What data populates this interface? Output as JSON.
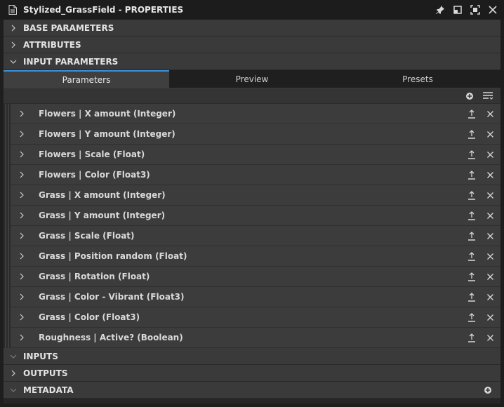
{
  "window": {
    "title": "Stylized_GrassField - PROPERTIES"
  },
  "sections": {
    "base_parameters": "BASE PARAMETERS",
    "attributes": "ATTRIBUTES",
    "input_parameters": "INPUT PARAMETERS",
    "inputs": "INPUTS",
    "outputs": "OUTPUTS",
    "metadata": "METADATA"
  },
  "tabs": [
    {
      "label": "Parameters",
      "active": true
    },
    {
      "label": "Preview",
      "active": false
    },
    {
      "label": "Presets",
      "active": false
    }
  ],
  "parameters": [
    "Flowers | X amount (Integer)",
    "Flowers | Y amount (Integer)",
    "Flowers | Scale (Float)",
    "Flowers | Color (Float3)",
    "Grass | X amount (Integer)",
    "Grass | Y amount (Integer)",
    "Grass | Scale (Float)",
    "Grass | Position random (Float)",
    "Grass | Rotation (Float)",
    "Grass | Color - Vibrant (Float3)",
    "Grass | Color (Float3)",
    "Roughness | Active? (Boolean)"
  ],
  "colors": {
    "accent": "#3b8fd9",
    "panel": "#3c3c3c",
    "header": "#3a3a3a",
    "titlebar": "#1c1c1c"
  },
  "icons": {
    "title": "document-icon",
    "pin": "pin-icon",
    "restore": "restore-window-icon",
    "maximize": "maximize-icon",
    "close": "close-icon",
    "add": "add-circle-icon",
    "menu": "filter-menu-icon",
    "expose": "upload-icon",
    "remove": "close-x-icon"
  }
}
